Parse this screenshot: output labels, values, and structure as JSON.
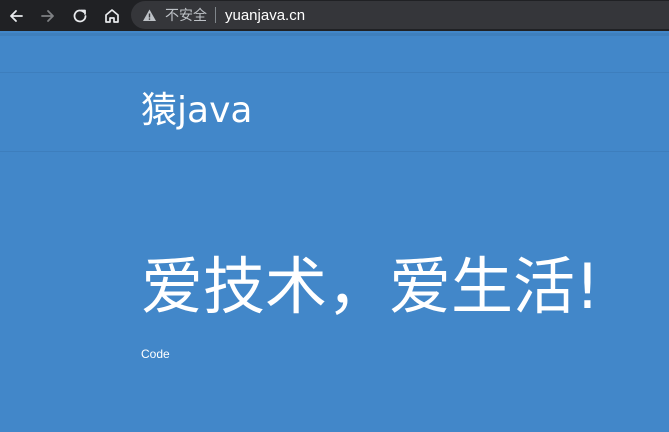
{
  "browser": {
    "security_label": "不安全",
    "url": "yuanjava.cn",
    "icons": {
      "back": "back-arrow-icon",
      "forward": "forward-arrow-icon",
      "reload": "reload-icon",
      "home": "home-icon",
      "security": "warning-triangle-icon"
    }
  },
  "site": {
    "brand": "猿java",
    "hero_title": "爱技术，爱生活!",
    "hero_subtitle": "Code"
  },
  "colors": {
    "page_background": "#4287c9",
    "toolbar_background": "#202124",
    "omnibox_background": "#35363a",
    "text": "#ffffff"
  }
}
